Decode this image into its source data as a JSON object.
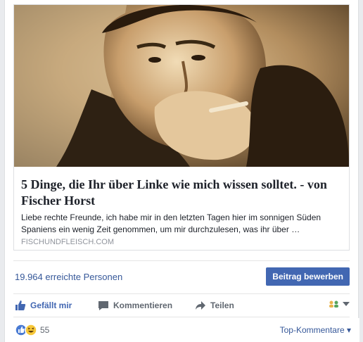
{
  "link_card": {
    "title": "5 Dinge, die Ihr über Linke wie mich wissen solltet. - von Fischer Horst",
    "description": "Liebe rechte Freunde, ich habe mir in den letzten Tagen hier im sonnigen Süden Spaniens ein wenig Zeit genommen, um mir durchzulesen, was ihr über …",
    "domain": "FISCHUNDFLEISCH.COM"
  },
  "reach": {
    "text": "19.964 erreichte Personen",
    "boost_label": "Beitrag bewerben"
  },
  "actions": {
    "like": "Gefällt mir",
    "comment": "Kommentieren",
    "share": "Teilen"
  },
  "reactions": {
    "count": "55",
    "sort_label": "Top-Kommentare"
  },
  "colors": {
    "link_blue": "#365899",
    "button_blue": "#4267b2",
    "like_blue": "#4267b2",
    "action_gray": "#606770"
  },
  "icons": [
    "thumbs-up-icon",
    "comment-icon",
    "share-arrow-icon",
    "audience-icon",
    "chevron-down-icon",
    "like-reaction-icon",
    "haha-reaction-icon"
  ]
}
